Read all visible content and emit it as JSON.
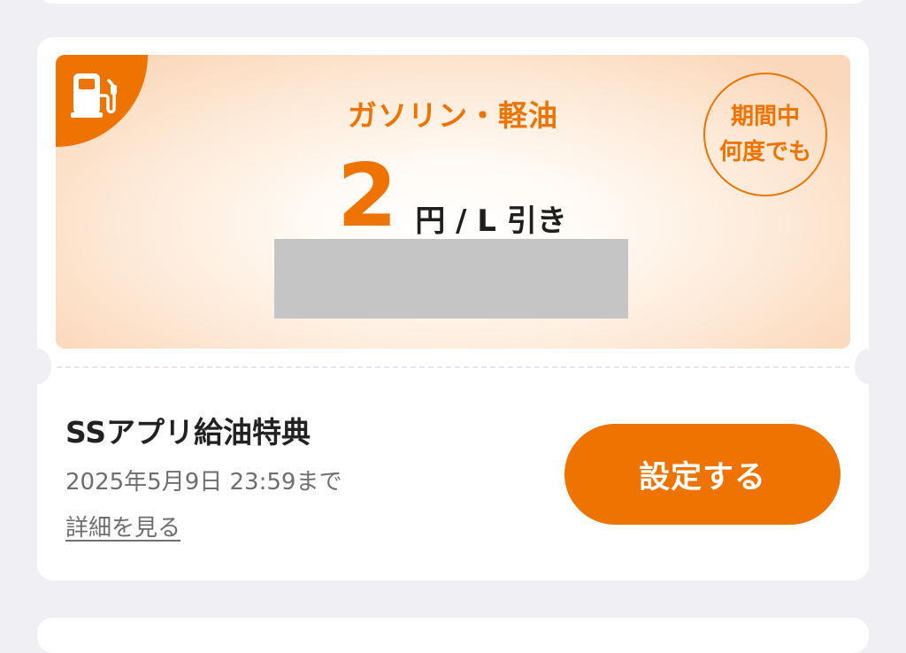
{
  "coupon": {
    "fuel_type": "ガソリン・軽油",
    "discount_amount": "2",
    "discount_unit": "円 / L 引き",
    "badge_line1": "期間中",
    "badge_line2": "何度でも",
    "title": "SSアプリ給油特典",
    "expiry": "2025年5月9日 23:59まで",
    "details_link": "詳細を見る",
    "setup_button": "設定する",
    "corner_icon": "fuel-pump-icon"
  },
  "colors": {
    "accent": "#ee7300",
    "background": "#efeff4",
    "card": "#ffffff",
    "text": "#222222",
    "subtext": "#6e6e6e"
  }
}
